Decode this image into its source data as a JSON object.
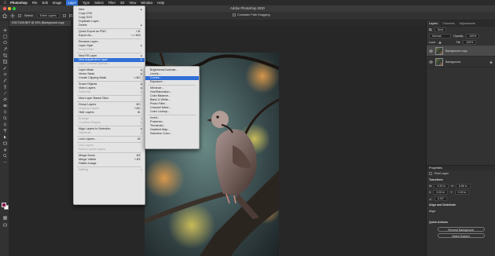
{
  "menubar": {
    "app": "Photoshop",
    "items": [
      "File",
      "Edit",
      "Image",
      "Layer",
      "Type",
      "Select",
      "Filter",
      "3D",
      "View",
      "Window",
      "Help"
    ],
    "active": "Layer"
  },
  "window": {
    "title": "Adobe Photoshop 2020"
  },
  "options_bar": {
    "select_label": "Select:",
    "select_value": "Entire Layers",
    "zoom_mode": "Constrain Path Dragging"
  },
  "document": {
    "tab": "DSC7428.NEF @ 33% (Background copy"
  },
  "layer_menu": {
    "items": [
      {
        "label": "New",
        "arrow": true
      },
      {
        "label": "Copy CSS"
      },
      {
        "label": "Copy SVG"
      },
      {
        "label": "Duplicate Layer..."
      },
      {
        "label": "Delete",
        "arrow": true
      },
      {
        "sep": true
      },
      {
        "label": "Quick Export as PNG",
        "shortcut": "⇧⌘'"
      },
      {
        "label": "Export As...",
        "shortcut": "⌥⇧⌘W"
      },
      {
        "sep": true
      },
      {
        "label": "Rename Layer..."
      },
      {
        "label": "Layer Style",
        "arrow": true
      },
      {
        "label": "Smart Filter",
        "disabled": true
      },
      {
        "sep": true
      },
      {
        "label": "New Fill Layer",
        "arrow": true
      },
      {
        "label": "New Adjustment Layer",
        "arrow": true,
        "highlight": true
      },
      {
        "label": "Layer Content Options...",
        "disabled": true
      },
      {
        "sep": true
      },
      {
        "label": "Layer Mask",
        "arrow": true
      },
      {
        "label": "Vector Mask",
        "arrow": true
      },
      {
        "label": "Create Clipping Mask",
        "shortcut": "⌥⌘G"
      },
      {
        "sep": true
      },
      {
        "label": "Smart Objects",
        "arrow": true
      },
      {
        "label": "Video Layers",
        "arrow": true
      },
      {
        "label": "Rasterize",
        "arrow": true,
        "disabled": true
      },
      {
        "sep": true
      },
      {
        "label": "New Layer Based Slice"
      },
      {
        "sep": true
      },
      {
        "label": "Group Layers",
        "shortcut": "⌘G"
      },
      {
        "label": "Ungroup Layers",
        "shortcut": "⇧⌘G",
        "disabled": true
      },
      {
        "label": "Hide Layers",
        "shortcut": "⌘,"
      },
      {
        "sep": true
      },
      {
        "label": "Arrange",
        "arrow": true,
        "disabled": true
      },
      {
        "label": "Combine Shapes",
        "arrow": true,
        "disabled": true
      },
      {
        "sep": true
      },
      {
        "label": "Align Layers to Selection",
        "arrow": true
      },
      {
        "label": "Distribute",
        "arrow": true,
        "disabled": true
      },
      {
        "sep": true
      },
      {
        "label": "Lock Layers...",
        "shortcut": "⌘/"
      },
      {
        "sep": true
      },
      {
        "label": "Link Layers",
        "disabled": true
      },
      {
        "label": "Select Linked Layers",
        "disabled": true
      },
      {
        "sep": true
      },
      {
        "label": "Merge Down",
        "shortcut": "⌘E"
      },
      {
        "label": "Merge Visible",
        "shortcut": "⇧⌘E"
      },
      {
        "label": "Flatten Image"
      },
      {
        "sep": true
      },
      {
        "label": "Matting",
        "arrow": true,
        "disabled": true
      }
    ]
  },
  "adjustment_submenu": {
    "items": [
      {
        "label": "Brightness/Contrast..."
      },
      {
        "label": "Levels..."
      },
      {
        "label": "Curves...",
        "highlight": true
      },
      {
        "label": "Exposure..."
      },
      {
        "sep": true
      },
      {
        "label": "Vibrance..."
      },
      {
        "label": "Hue/Saturation..."
      },
      {
        "label": "Color Balance..."
      },
      {
        "label": "Black & White..."
      },
      {
        "label": "Photo Filter..."
      },
      {
        "label": "Channel Mixer..."
      },
      {
        "label": "Color Lookup..."
      },
      {
        "sep": true
      },
      {
        "label": "Invert..."
      },
      {
        "label": "Posterize..."
      },
      {
        "label": "Threshold..."
      },
      {
        "label": "Gradient Map..."
      },
      {
        "label": "Selective Color..."
      }
    ]
  },
  "panels": {
    "tabs": [
      "Layers",
      "Channels",
      "Adjustments"
    ],
    "search": "Kind",
    "blend_mode": "Normal",
    "opacity_label": "Opacity:",
    "opacity_value": "100%",
    "lock_label": "Lock:",
    "fill_label": "Fill:",
    "fill_value": "100%",
    "layers": [
      {
        "name": "Background copy",
        "selected": true
      },
      {
        "name": "Background",
        "selected": false
      }
    ],
    "properties_title": "Properties",
    "pixel_layer": "Pixel Layer",
    "transform_title": "Transform",
    "w_label": "W",
    "w_value": "9.32 in",
    "h_label": "H",
    "h_value": "6.88 in",
    "x_label": "X",
    "x_value": "0.00 in",
    "y_label": "Y",
    "y_value": "0.00 in",
    "angle_value": "0.00°",
    "align_title": "Align and Distribute",
    "align_sub": "Align:",
    "quick_actions_title": "Quick Actions",
    "remove_bg_label": "Remove Background",
    "select_subject_label": "Select Subject"
  },
  "colors": {
    "menubar": "#2b2b2b",
    "accent": "#2f6fd6",
    "foreground_swatch": "#8b1a4c",
    "background_swatch": "#ffffff"
  }
}
